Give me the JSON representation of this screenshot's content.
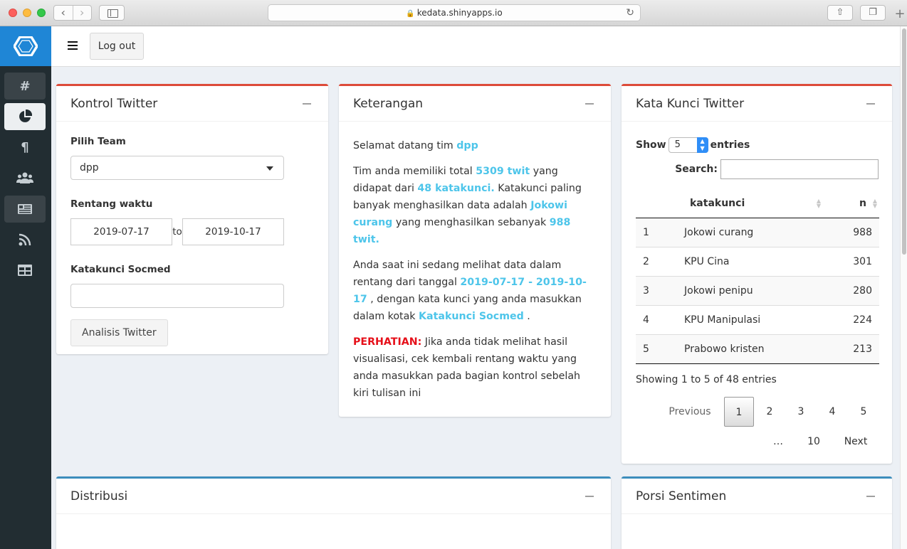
{
  "browser": {
    "url": "kedata.shinyapps.io"
  },
  "header": {
    "logout_label": "Log out"
  },
  "sidebar": {
    "items": [
      {
        "icon": "hash-icon",
        "glyph": "#"
      },
      {
        "icon": "pie-chart-icon",
        "glyph": ""
      },
      {
        "icon": "paragraph-icon",
        "glyph": "¶"
      },
      {
        "icon": "users-icon",
        "glyph": ""
      },
      {
        "icon": "newspaper-icon",
        "glyph": ""
      },
      {
        "icon": "rss-icon",
        "glyph": ""
      },
      {
        "icon": "table-icon",
        "glyph": ""
      }
    ]
  },
  "kontrol": {
    "title": "Kontrol Twitter",
    "team_label": "Pilih Team",
    "team_value": "dpp",
    "range_label": "Rentang waktu",
    "date_from": "2019-07-17",
    "date_sep": "to",
    "date_to": "2019-10-17",
    "keyword_label": "Katakunci Socmed",
    "keyword_value": "",
    "button_label": "Analisis Twitter"
  },
  "keterangan": {
    "title": "Keterangan",
    "p1_a": "Selamat datang tim ",
    "p1_team": "dpp",
    "p2_a": "Tim anda memiliki total ",
    "p2_total": "5309 twit",
    "p2_b": " yang didapat dari ",
    "p2_kw": "48 katakunci.",
    "p2_c": " Katakunci paling banyak menghasilkan data adalah ",
    "p2_top": "Jokowi curang",
    "p2_d": " yang menghasilkan sebanyak ",
    "p2_count": "988 twit.",
    "p3_a": "Anda saat ini sedang melihat data dalam rentang dari tanggal ",
    "p3_range": "2019-07-17 - 2019-10-17",
    "p3_b": " , dengan kata kunci yang anda masukkan dalam kotak ",
    "p3_box": "Katakunci Socmed",
    "p3_c": " .",
    "p4_warn": "PERHATIAN:",
    "p4_text": " Jika anda tidak melihat hasil visualisasi, cek kembali rentang waktu yang anda masukkan pada bagian kontrol sebelah kiri tulisan ini"
  },
  "katakunci": {
    "title": "Kata Kunci Twitter",
    "show_label": "Show",
    "length_value": "5",
    "entries_label": "entries",
    "search_label": "Search:",
    "columns": [
      "",
      "katakunci",
      "n"
    ],
    "rows": [
      {
        "idx": "1",
        "kw": "Jokowi curang",
        "n": "988"
      },
      {
        "idx": "2",
        "kw": "KPU Cina",
        "n": "301"
      },
      {
        "idx": "3",
        "kw": "Jokowi penipu",
        "n": "280"
      },
      {
        "idx": "4",
        "kw": "KPU Manipulasi",
        "n": "224"
      },
      {
        "idx": "5",
        "kw": "Prabowo kristen",
        "n": "213"
      }
    ],
    "info": "Showing 1 to 5 of 48 entries",
    "pager": {
      "previous": "Previous",
      "pages": [
        "1",
        "2",
        "3",
        "4",
        "5"
      ],
      "ellipsis": "…",
      "last": "10",
      "next": "Next"
    }
  },
  "distribusi": {
    "title": "Distribusi"
  },
  "sentimen": {
    "title": "Porsi Sentimen"
  },
  "colors": {
    "sidebar": "#222d32",
    "logo": "#1f86d6",
    "highlight": "#4dc5ea",
    "warning": "#e6101a",
    "box_red": "#dd4b39",
    "box_blue": "#3c8dbc"
  }
}
